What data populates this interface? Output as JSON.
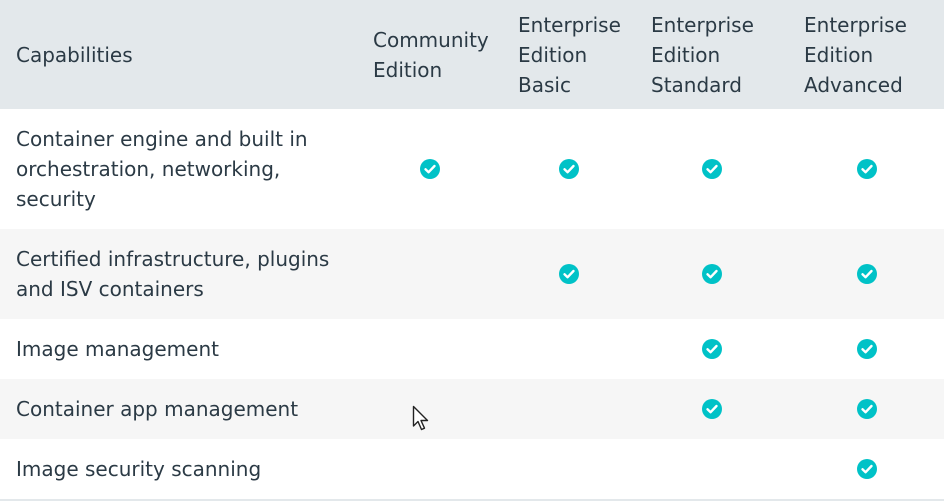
{
  "header": {
    "capabilities": "Capabilities",
    "community": "Community\nEdition",
    "ee_basic": "Enterprise\nEdition\nBasic",
    "ee_standard": "Enterprise\nEdition\nStandard",
    "ee_advanced": "Enterprise\nEdition\nAdvanced"
  },
  "rows": [
    {
      "label": "Container engine and built in orchestration, networking, security",
      "community": true,
      "basic": true,
      "standard": true,
      "advanced": true
    },
    {
      "label": "Certified infrastructure, plugins and ISV containers",
      "community": false,
      "basic": true,
      "standard": true,
      "advanced": true
    },
    {
      "label": "Image management",
      "community": false,
      "basic": false,
      "standard": true,
      "advanced": true
    },
    {
      "label": "Container app management",
      "community": false,
      "basic": false,
      "standard": true,
      "advanced": true
    },
    {
      "label": "Image security scanning",
      "community": false,
      "basic": false,
      "standard": false,
      "advanced": true
    }
  ],
  "icons": {
    "check": "check-circle-icon",
    "cursor": "mouse-pointer-icon"
  },
  "colors": {
    "check": "#00c2c7",
    "header_bg": "#e3e8eb",
    "alt_row_bg": "#f6f6f6",
    "text": "#2b3a45"
  }
}
